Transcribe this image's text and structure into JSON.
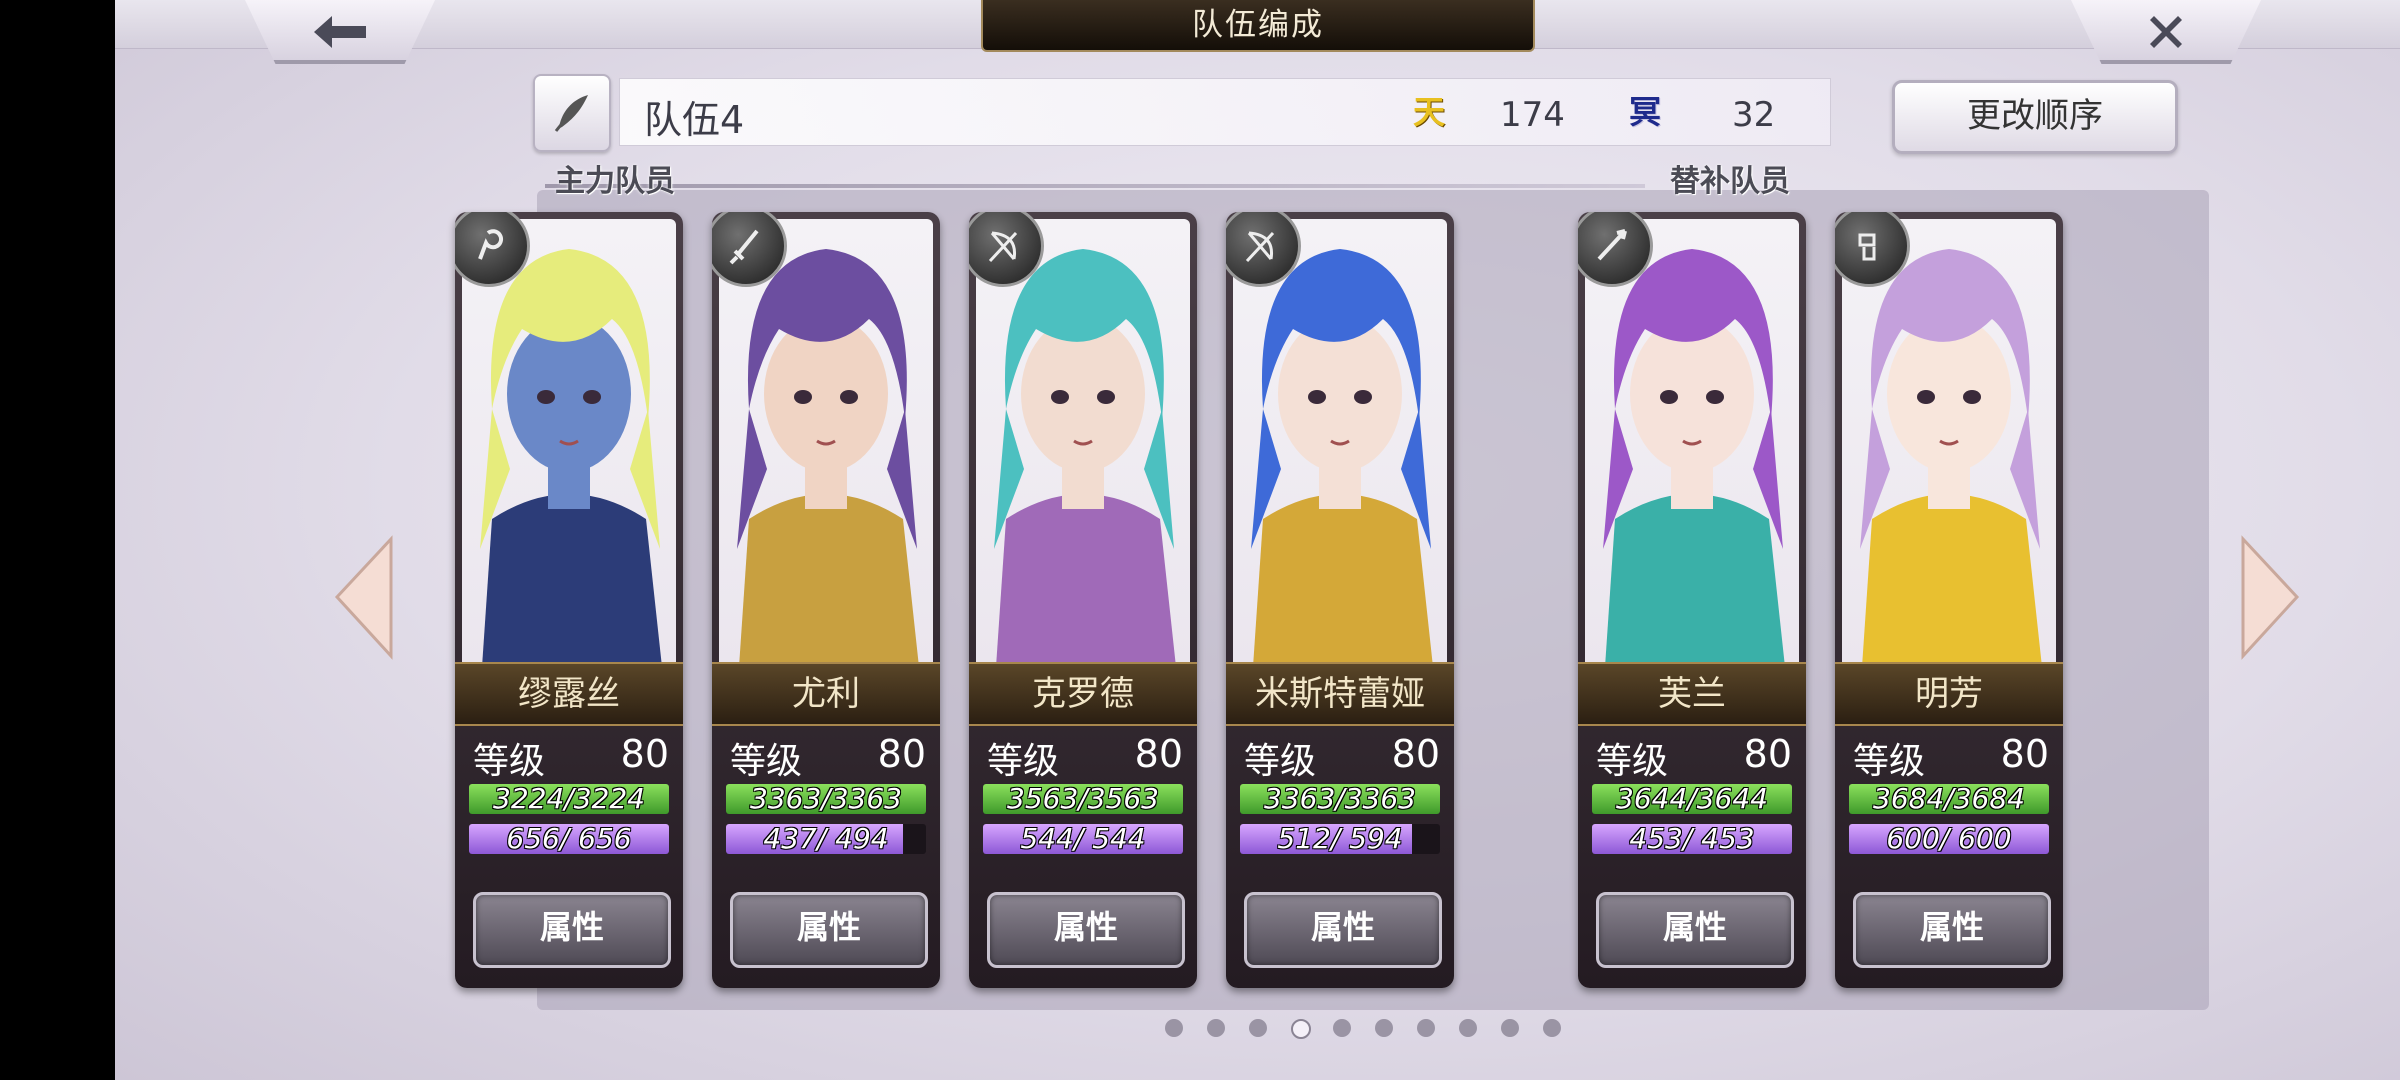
{
  "header": {
    "title": "队伍编成",
    "back_icon": "arrow-left-icon",
    "close_icon": "close-x-icon"
  },
  "team": {
    "name": "队伍4",
    "ten_badge": "天",
    "ten_value": "174",
    "ming_badge": "冥",
    "ming_value": "32"
  },
  "reorder_label": "更改顺序",
  "main_members_label": "主力队员",
  "sub_members_label": "替补队员",
  "colors": {
    "hp": "#5fbf3a",
    "mp": "#b07ef0",
    "name_plate": "#3a2c1a"
  },
  "members": [
    {
      "name": "缪露丝",
      "level_label": "等级",
      "level": "80",
      "hp": "3224/3224",
      "hp_ratio": 1.0,
      "mp": "656/ 656",
      "mp_ratio": 1.0,
      "weapon": "staff-icon",
      "attr_label": "属性",
      "hair": "#e6ec7c",
      "skin": "#6a88c8",
      "accent": "#2c3c78"
    },
    {
      "name": "尤利",
      "level_label": "等级",
      "level": "80",
      "hp": "3363/3363",
      "hp_ratio": 1.0,
      "mp": "437/ 494",
      "mp_ratio": 0.885,
      "weapon": "sword-icon",
      "attr_label": "属性",
      "hair": "#6c4ea0",
      "skin": "#f0d4c4",
      "accent": "#c8a040"
    },
    {
      "name": "克罗德",
      "level_label": "等级",
      "level": "80",
      "hp": "3563/3563",
      "hp_ratio": 1.0,
      "mp": "544/ 544",
      "mp_ratio": 1.0,
      "weapon": "bow-icon",
      "attr_label": "属性",
      "hair": "#4cc0c0",
      "skin": "#f2dcd0",
      "accent": "#a06ab8"
    },
    {
      "name": "米斯特蕾娅",
      "level_label": "等级",
      "level": "80",
      "hp": "3363/3363",
      "hp_ratio": 1.0,
      "mp": "512/ 594",
      "mp_ratio": 0.862,
      "weapon": "bow-icon",
      "attr_label": "属性",
      "hair": "#3e6ad8",
      "skin": "#f4e0d6",
      "accent": "#d4a838"
    },
    {
      "name": "芙兰",
      "level_label": "等级",
      "level": "80",
      "hp": "3644/3644",
      "hp_ratio": 1.0,
      "mp": "453/ 453",
      "mp_ratio": 1.0,
      "weapon": "spear-icon",
      "attr_label": "属性",
      "hair": "#9c58c8",
      "skin": "#f6e2da",
      "accent": "#3ab0a8"
    },
    {
      "name": "明芳",
      "level_label": "等级",
      "level": "80",
      "hp": "3684/3684",
      "hp_ratio": 1.0,
      "mp": "600/ 600",
      "mp_ratio": 1.0,
      "weapon": "gauntlet-icon",
      "attr_label": "属性",
      "hair": "#c4a0dc",
      "skin": "#f8e6dc",
      "accent": "#e8c030"
    }
  ],
  "pager": {
    "total": 10,
    "active": 4
  }
}
